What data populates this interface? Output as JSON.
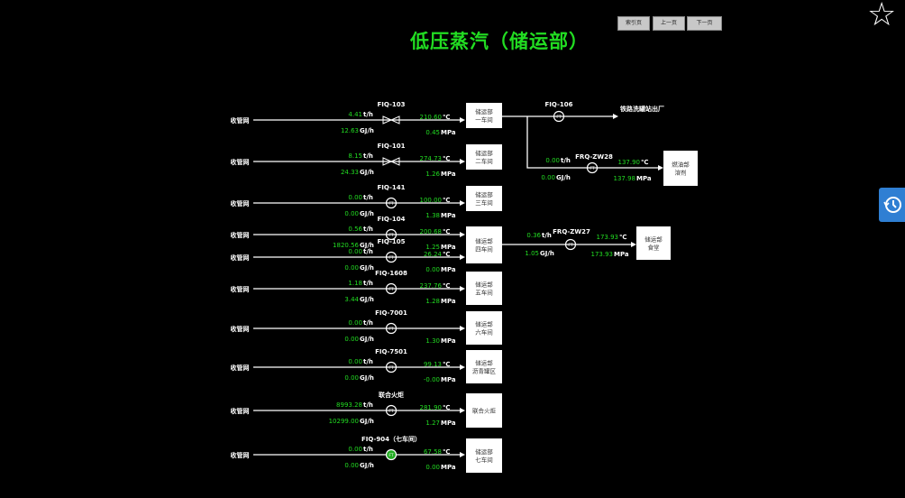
{
  "title": "低压蒸汽（储运部）",
  "nav": {
    "home": "索引页",
    "prev": "上一页",
    "next": "下一页"
  },
  "source_label": "收管网",
  "units": {
    "flow": "t/h",
    "energy": "GJ/h",
    "temp": "℃",
    "pressure": "MPa"
  },
  "rows": [
    {
      "tag": "FIQ-103",
      "flow": "4.41",
      "energy": "12.63",
      "temp": "210.60",
      "pressure": "0.45",
      "dest": [
        "储运部",
        "一车间"
      ],
      "meter": "valve"
    },
    {
      "tag": "FIQ-101",
      "flow": "8.15",
      "energy": "24.33",
      "temp": "274.73",
      "pressure": "1.26",
      "dest": [
        "储运部",
        "二车间"
      ],
      "meter": "valve"
    },
    {
      "tag": "FIQ-141",
      "flow": "0.00",
      "energy": "0.00",
      "temp": "100.00",
      "pressure": "1.38",
      "dest": [
        "储运部",
        "三车间"
      ],
      "meter": "FT"
    },
    {
      "tag": "FIQ-104",
      "flow": "0.56",
      "energy": "1820.56",
      "temp": "200.68",
      "pressure": "1.25",
      "dest": [
        "储运部",
        "四车间"
      ],
      "meter": "FT"
    },
    {
      "tag": "FIQ-105",
      "flow": "0.00",
      "energy": "0.00",
      "temp": "26.24",
      "pressure": "0.00",
      "dest": null,
      "meter": "FT"
    },
    {
      "tag": "FIQ-1608",
      "flow": "1.18",
      "energy": "3.44",
      "temp": "237.76",
      "pressure": "1.28",
      "dest": [
        "储运部",
        "五车间"
      ],
      "meter": "FT"
    },
    {
      "tag": "FIQ-7001",
      "flow": "0.00",
      "energy": "0.00",
      "temp": "",
      "pressure": "1.30",
      "dest": [
        "储运部",
        "六车间"
      ],
      "meter": "FT"
    },
    {
      "tag": "FIQ-7501",
      "flow": "0.00",
      "energy": "0.00",
      "temp": "99.13",
      "pressure": "-0.00",
      "dest": [
        "储运部",
        "沥青罐区"
      ],
      "meter": "FT"
    },
    {
      "tag": "联合火炬",
      "flow": "8993.28",
      "energy": "10299.00",
      "temp": "281.90",
      "pressure": "1.27",
      "dest": [
        "联合火炬"
      ],
      "meter": "FT"
    },
    {
      "tag": "FIQ-904（七车间）",
      "flow": "0.00",
      "energy": "0.00",
      "temp": "67.58",
      "pressure": "0.00",
      "dest": [
        "储运部",
        "七车间"
      ],
      "meter": "FT-green"
    }
  ],
  "branches": {
    "fiq106": {
      "tag": "FIQ-106",
      "dest": "铁路洗罐站出厂"
    },
    "zw28": {
      "tag": "FRQ-ZW28",
      "flow": "0.00",
      "energy": "0.00",
      "temp": "137.90",
      "pressure": "137.98",
      "dest": [
        "燃油部",
        "溶剂"
      ]
    },
    "zw27": {
      "tag": "FRQ-ZW27",
      "flow": "0.36",
      "energy": "1.05",
      "temp": "173.93",
      "pressure": "173.93",
      "dest": [
        "储运部",
        "食堂"
      ]
    }
  },
  "ft_label": "FT"
}
